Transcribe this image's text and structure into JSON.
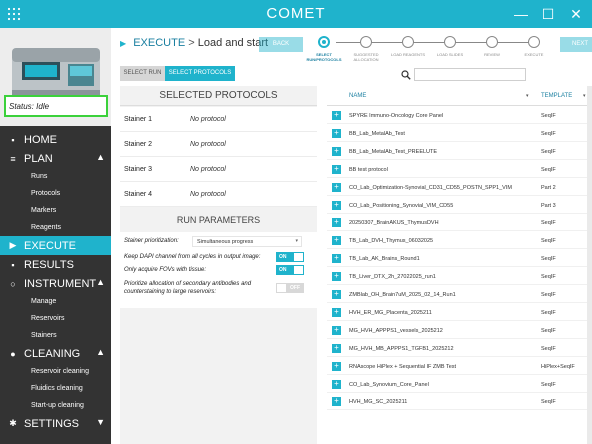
{
  "app": {
    "title": "COMET",
    "logo_icon": "comet-grid-logo-icon"
  },
  "window": {
    "minimize": "—",
    "maximize": "☐",
    "close": "✕"
  },
  "device": {
    "status_label": "Status:",
    "status_value": "Idle"
  },
  "nav": {
    "home": "HOME",
    "plan": "PLAN",
    "plan_items": [
      "Runs",
      "Protocols",
      "Markers",
      "Reagents"
    ],
    "execute": "EXECUTE",
    "results": "RESULTS",
    "instrument": "INSTRUMENT",
    "instrument_items": [
      "Manage",
      "Reservoirs",
      "Stainers"
    ],
    "cleaning": "CLEANING",
    "cleaning_items": [
      "Reservoir cleaning",
      "Fluidics cleaning",
      "Start-up cleaning"
    ],
    "settings": "SETTINGS"
  },
  "header": {
    "crumb_section": "EXECUTE",
    "crumb_sep": ">",
    "crumb_page": "Load and start",
    "back_label": "BACK",
    "next_label": "NEXT"
  },
  "steps": [
    {
      "label": "SELECT RUN/PROTOCOLS",
      "active": true
    },
    {
      "label": "SUGGESTED ALLOCATION",
      "active": false
    },
    {
      "label": "LOAD REAGENTS",
      "active": false
    },
    {
      "label": "LOAD SLIDES",
      "active": false
    },
    {
      "label": "REVIEW",
      "active": false
    },
    {
      "label": "EXECUTE",
      "active": false
    }
  ],
  "toggle": {
    "select_run": "SELECT RUN",
    "select_protocols": "SELECT PROTOCOLS"
  },
  "selected_protocols": {
    "heading": "SELECTED PROTOCOLS",
    "rows": [
      {
        "stainer": "Stainer 1",
        "protocol": "No protocol"
      },
      {
        "stainer": "Stainer 2",
        "protocol": "No protocol"
      },
      {
        "stainer": "Stainer 3",
        "protocol": "No protocol"
      },
      {
        "stainer": "Stainer 4",
        "protocol": "No protocol"
      }
    ]
  },
  "run_parameters": {
    "heading": "RUN PARAMETERS",
    "prioritization_label": "Stainer prioritization:",
    "prioritization_value": "Simultaneous progress",
    "dapi_label": "Keep DAPI channel from all cycles in output image:",
    "dapi_state": "ON",
    "fov_label": "Only acquire FOVs with tissue:",
    "fov_state": "ON",
    "priority_label": "Prioritize allocation of secondary antibodies and counterstaining to large reservoirs:",
    "priority_state": "OFF"
  },
  "search": {
    "placeholder": ""
  },
  "protocol_table": {
    "col_name": "NAME",
    "col_template": "TEMPLATE",
    "sort_icon": "▾",
    "rows": [
      {
        "name": "SPYRE Immuno-Oncology Core Panel",
        "template": "SeqIF"
      },
      {
        "name": "BB_Lab_MetalAb_Test",
        "template": "SeqIF"
      },
      {
        "name": "BB_Lab_MetalAb_Test_PREELUTE",
        "template": "SeqIF"
      },
      {
        "name": "BB test protocol",
        "template": "SeqIF"
      },
      {
        "name": "CO_Lab_Optimization-Synovial_CD31_CD55_POSTN_SPP1_VIM",
        "template": "Part 2"
      },
      {
        "name": "CO_Lab_Positioning_Synovial_VIM_CD55",
        "template": "Part 3"
      },
      {
        "name": "20250307_BrainAKUS_ThymusDVH",
        "template": "SeqIF"
      },
      {
        "name": "TB_Lab_DVH_Thymus_06032025",
        "template": "SeqIF"
      },
      {
        "name": "TB_Lab_AK_Brains_Round1",
        "template": "SeqIF"
      },
      {
        "name": "TB_Liver_DTX_2h_27022025_run1",
        "template": "SeqIF"
      },
      {
        "name": "ZMBlab_OH_Brain7uM_2025_02_14_Run1",
        "template": "SeqIF"
      },
      {
        "name": "HVH_ER_MG_Placenta_2025211",
        "template": "SeqIF"
      },
      {
        "name": "MG_HVH_APPPS1_vessels_2025212",
        "template": "SeqIF"
      },
      {
        "name": "MG_HVH_MB_APPPS1_TGFB1_2025212",
        "template": "SeqIF"
      },
      {
        "name": "RNAscope HiPlex + Sequential IF ZMB Test",
        "template": "HiPlex+SeqIF"
      },
      {
        "name": "CO_Lab_Synovium_Core_Panel",
        "template": "SeqIF"
      },
      {
        "name": "HVH_MG_SC_2025211",
        "template": "SeqIF"
      }
    ]
  },
  "colors": {
    "accent": "#1fb3cc",
    "sidebar": "#333333",
    "status_border": "#3bd13b"
  }
}
